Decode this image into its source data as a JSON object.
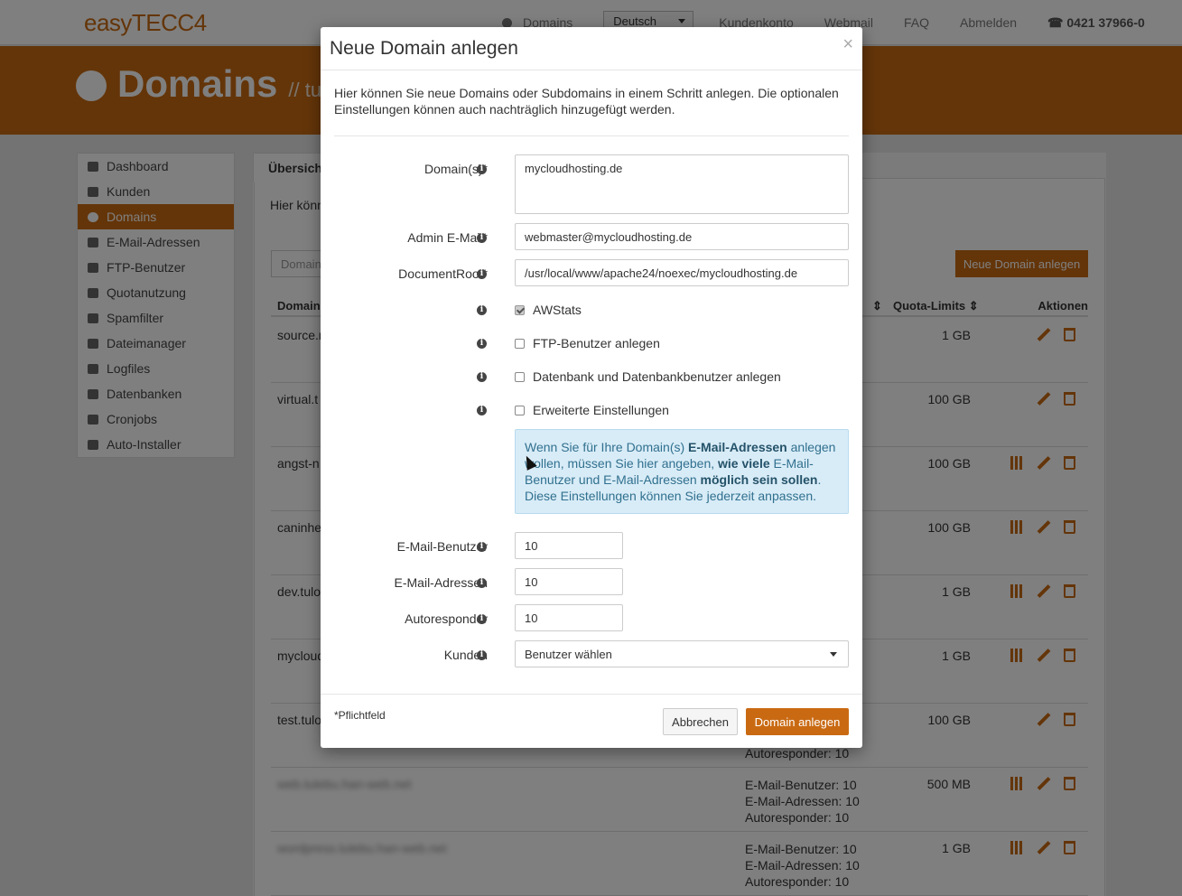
{
  "app": {
    "logo_text": "easyTECC4",
    "nav": {
      "domains": "Domains",
      "language": "Deutsch",
      "account": "Kundenkonto",
      "webmail": "Webmail",
      "faq": "FAQ",
      "logout": "Abmelden",
      "phone": "0421 37966-0"
    }
  },
  "banner": {
    "title": "Domains",
    "subtitle": "// tul"
  },
  "sidebar": {
    "items": [
      {
        "label": "Dashboard",
        "icon": "dashboard-icon"
      },
      {
        "label": "Kunden",
        "icon": "users-icon"
      },
      {
        "label": "Domains",
        "icon": "globe-icon",
        "active": true
      },
      {
        "label": "E-Mail-Adressen",
        "icon": "envelope-icon"
      },
      {
        "label": "FTP-Benutzer",
        "icon": "user-icon"
      },
      {
        "label": "Quotanutzung",
        "icon": "server-icon"
      },
      {
        "label": "Spamfilter",
        "icon": "filter-icon"
      },
      {
        "label": "Dateimanager",
        "icon": "folder-icon"
      },
      {
        "label": "Logfiles",
        "icon": "calendar-icon"
      },
      {
        "label": "Datenbanken",
        "icon": "list-icon"
      },
      {
        "label": "Cronjobs",
        "icon": "clock-icon"
      },
      {
        "label": "Auto-Installer",
        "icon": "wand-icon"
      }
    ]
  },
  "main": {
    "tab": "Übersicht",
    "intro": "Hier könn",
    "search_placeholder": "Domain",
    "new_button": "Neue Domain anlegen",
    "headers": {
      "domain": "Domain",
      "quota": "Quota-Limits",
      "actions": "Aktionen"
    },
    "rows": [
      {
        "domain": "source.r",
        "quota": "1 GB",
        "limits": [
          "",
          "",
          ""
        ],
        "stats": false
      },
      {
        "domain": "virtual.t",
        "quota": "100 GB",
        "limits": [
          "",
          "",
          ""
        ],
        "stats": false
      },
      {
        "domain": "angst-n",
        "quota": "100 GB",
        "limits": [
          "",
          "",
          ""
        ],
        "stats": true
      },
      {
        "domain": "caninhe",
        "quota": "100 GB",
        "limits": [
          "",
          "",
          ""
        ],
        "stats": true
      },
      {
        "domain": "dev.tulo",
        "quota": "1 GB",
        "limits": [
          "",
          "",
          ""
        ],
        "stats": true
      },
      {
        "domain": "mycloud",
        "quota": "1 GB",
        "limits": [
          "",
          "",
          ""
        ],
        "stats": true
      },
      {
        "domain": "test.tulo",
        "quota": "100 GB",
        "limits": [
          "",
          "",
          "Autoresponder: 10"
        ],
        "stats": false
      },
      {
        "domain": "web.tulebu.han-web.net",
        "blurred": true,
        "quota": "500 MB",
        "limits": [
          "E-Mail-Benutzer: 10",
          "E-Mail-Adressen: 10",
          "Autoresponder: 10"
        ],
        "stats": true
      },
      {
        "domain": "wordpress.tulebu.han-web.net",
        "blurred": true,
        "quota": "1 GB",
        "limits": [
          "E-Mail-Benutzer: 10",
          "E-Mail-Adressen: 10",
          "Autoresponder: 10"
        ],
        "stats": true
      }
    ]
  },
  "modal": {
    "title": "Neue Domain anlegen",
    "close": "×",
    "intro": "Hier können Sie neue Domains oder Subdomains in einem Schritt anlegen. Die optionalen Einstellungen können auch nachträglich hinzugefügt werden.",
    "domains_label": "Domain(s)*",
    "domains_value": "mycloudhosting.de",
    "admin_email_label": "Admin E-Mail*",
    "admin_email_value": "webmaster@mycloudhosting.de",
    "docroot_label": "DocumentRoot*",
    "docroot_value": "/usr/local/www/apache24/noexec/mycloudhosting.de",
    "awstats_label": "AWStats",
    "ftp_label": "FTP-Benutzer anlegen",
    "db_label": "Datenbank und Datenbankbenutzer anlegen",
    "advanced_label": "Erweiterte Einstellungen",
    "alert": {
      "t1": "Wenn Sie für Ihre Domain(s) ",
      "b1": "E-Mail-Adressen",
      "t2": " anlegen wollen, müssen Sie hier angeben, ",
      "b2": "wie viele",
      "t3": " E-Mail-Benutzer und E-Mail-Adressen ",
      "b3": "möglich sein sollen",
      "t4": ". Diese Einstellungen können Sie jederzeit anpassen."
    },
    "mail_users_label": "E-Mail-Benutzer",
    "mail_users_value": "10",
    "mail_addresses_label": "E-Mail-Adressen",
    "mail_addresses_value": "10",
    "autoresponder_label": "Autoresponder",
    "autoresponder_value": "10",
    "customer_label": "Kunden",
    "customer_value": "Benutzer wählen",
    "required_note": "*Pflichtfeld",
    "cancel": "Abbrechen",
    "submit": "Domain anlegen"
  }
}
